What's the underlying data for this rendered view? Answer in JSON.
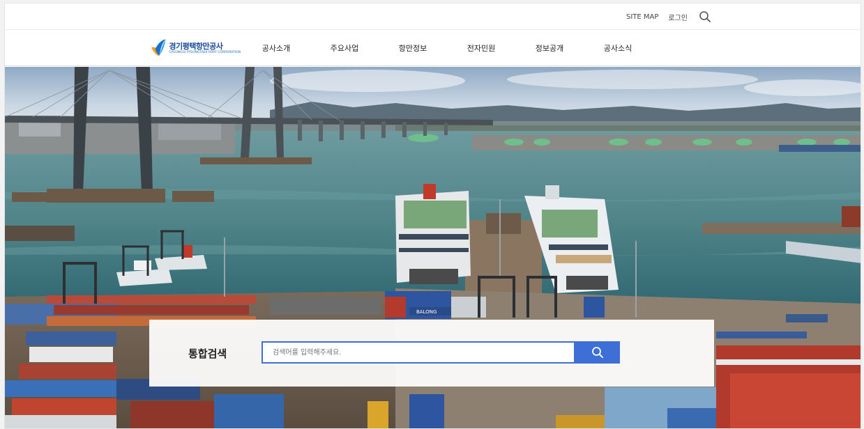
{
  "utility": {
    "links": [
      "SITE MAP",
      "로그인"
    ],
    "search_icon": "search-icon"
  },
  "logo": {
    "name": "경기평택항만공사",
    "english": "GYEONGGI PYEONGTAEK PORT CORPORATION",
    "icon": "logo-mark-icon"
  },
  "gnb": {
    "items": [
      "공사소개",
      "주요사업",
      "항만정보",
      "전자민원",
      "정보공개",
      "공사소식"
    ]
  },
  "search": {
    "label": "통합검색",
    "placeholder": "검색어를 입력해주세요.",
    "button_icon": "search-icon"
  },
  "hero": {
    "ship_label": "BALONG"
  },
  "colors": {
    "accent": "#3d6fd6",
    "brand": "#1a4a9a"
  }
}
